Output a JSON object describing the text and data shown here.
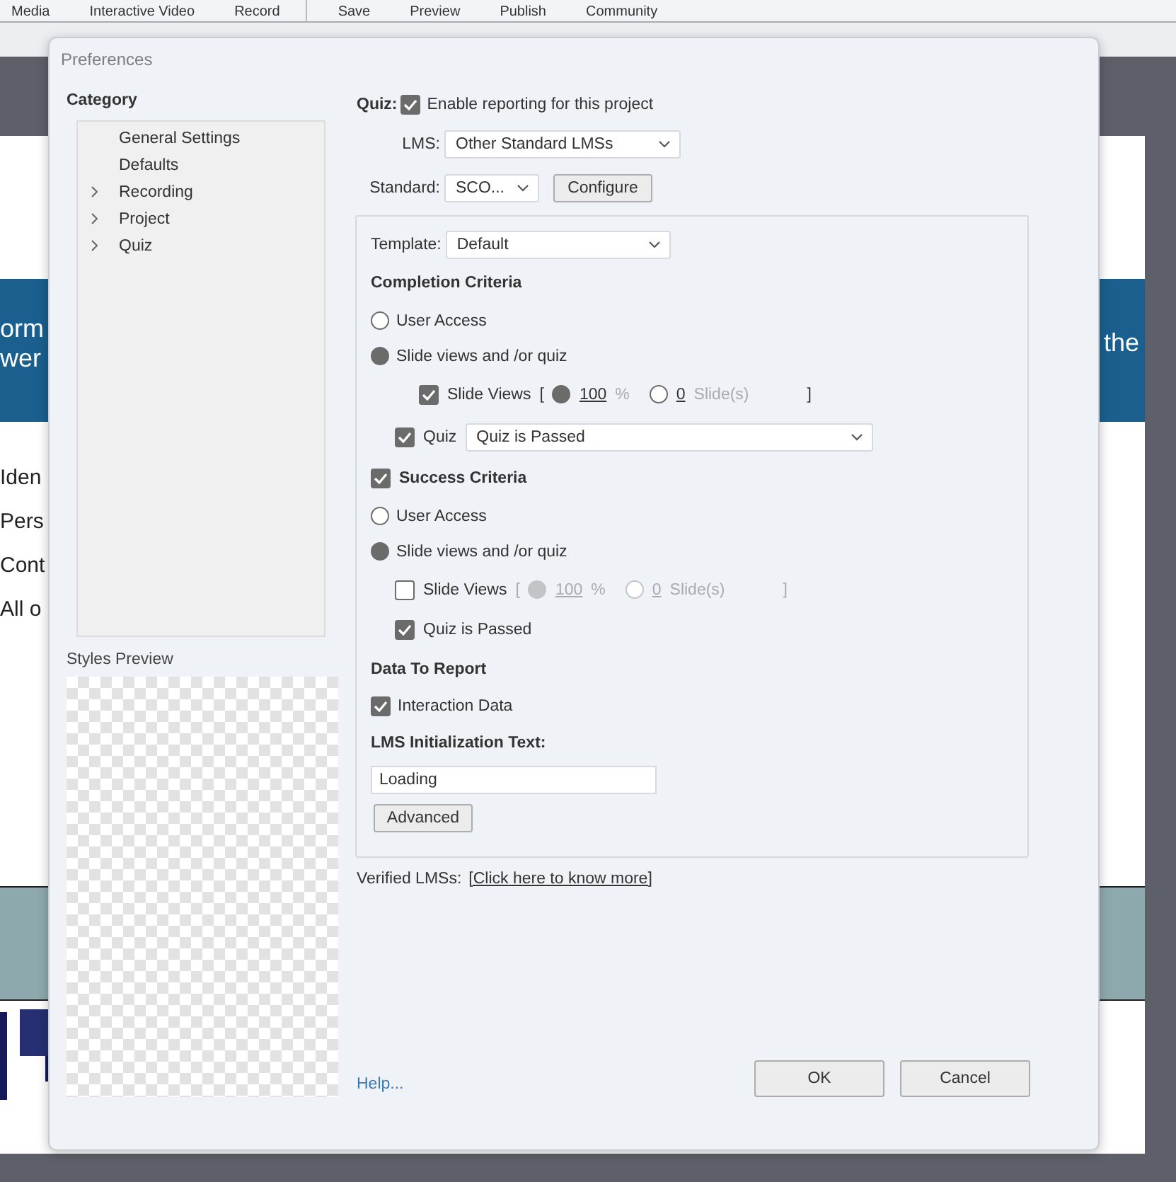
{
  "app_toolbar": {
    "groups": [
      [
        "Media",
        "Interactive Video",
        "Record"
      ],
      [
        "Save",
        "Preview",
        "Publish",
        "Community"
      ]
    ]
  },
  "slide": {
    "banner_left": [
      "orm",
      "wer"
    ],
    "banner_right": "the",
    "lines": [
      "Iden",
      "Pers",
      "Cont",
      "All o"
    ]
  },
  "dialog": {
    "title": "Preferences",
    "category": {
      "heading": "Category",
      "items": [
        {
          "label": "General Settings",
          "expandable": false
        },
        {
          "label": "Defaults",
          "expandable": false
        },
        {
          "label": "Recording",
          "expandable": true
        },
        {
          "label": "Project",
          "expandable": true
        },
        {
          "label": "Quiz",
          "expandable": true
        }
      ]
    },
    "styles_preview": {
      "heading": "Styles Preview"
    },
    "reporting": {
      "quiz_label": "Quiz:",
      "enable": {
        "label": "Enable reporting for this project",
        "checked": true
      },
      "lms": {
        "label": "LMS:",
        "value": "Other Standard LMSs"
      },
      "standard": {
        "label": "Standard:",
        "value": "SCO..."
      },
      "configure": "Configure",
      "template": {
        "label": "Template:",
        "value": "Default"
      },
      "completion": {
        "heading": "Completion Criteria",
        "options": [
          {
            "label": "User Access",
            "selected": false
          },
          {
            "label": "Slide views and /or quiz",
            "selected": true
          }
        ],
        "slide_views": {
          "label": "Slide Views",
          "checked": true,
          "disabled": false,
          "open": "[",
          "close": "]",
          "percent": "100",
          "percent_unit": "%",
          "percent_selected": true,
          "slides": "0",
          "slides_unit": "Slide(s)",
          "slides_selected": false
        },
        "quiz": {
          "label": "Quiz",
          "checked": true,
          "value": "Quiz is Passed"
        }
      },
      "success": {
        "label": "Success Criteria",
        "checked": true,
        "options": [
          {
            "label": "User Access",
            "selected": false
          },
          {
            "label": "Slide views and /or quiz",
            "selected": true
          }
        ],
        "slide_views": {
          "label": "Slide Views",
          "checked": false,
          "disabled": true,
          "open": "[",
          "close": "]",
          "percent": "100",
          "percent_unit": "%",
          "percent_selected": true,
          "slides": "0",
          "slides_unit": "Slide(s)",
          "slides_selected": false
        },
        "quiz_passed": {
          "label": "Quiz is Passed",
          "checked": true
        }
      },
      "data_to_report": {
        "heading": "Data To Report",
        "interaction": {
          "label": "Interaction Data",
          "checked": true
        }
      },
      "init_text": {
        "label": "LMS Initialization Text:",
        "value": "Loading"
      },
      "advanced": "Advanced",
      "verified": {
        "label": "Verified LMSs:",
        "link": "[Click here to know more]"
      }
    },
    "help": "Help...",
    "buttons": [
      "OK",
      "Cancel"
    ]
  }
}
